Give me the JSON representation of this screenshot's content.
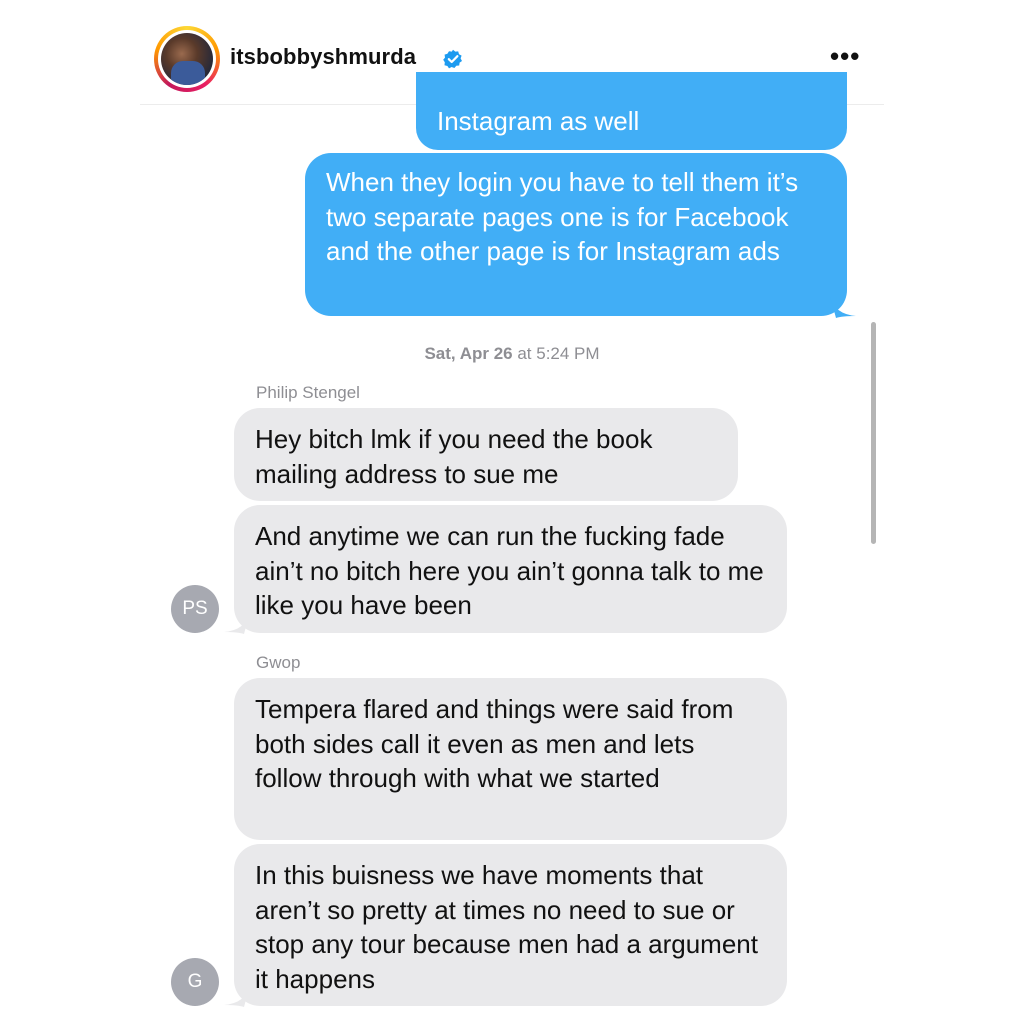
{
  "header": {
    "username": "itsbobbyshmurda",
    "verified_icon": "verified-badge-icon",
    "more_label": "•••"
  },
  "colors": {
    "outgoing": "#41aef6",
    "incoming": "#e9e9eb",
    "verified": "#1d9bf0"
  },
  "messages": {
    "out_1": "Instagram as well",
    "out_2": "When they login you have to tell them it’s two separate pages one is for Facebook and the other page is for Instagram ads",
    "ps_1": "Hey bitch lmk if you need the book mailing address to sue me",
    "ps_2": "And anytime we can run the fucking fade ain’t no bitch here you ain’t gonna talk to me like you have been",
    "g_1": "Tempera flared and things were said from both sides call it even as men and lets follow through with what we started",
    "g_2": "In this buisness we have moments that aren’t so pretty at times no need to sue or stop any tour because men had a argument it happens"
  },
  "timestamp": {
    "day": "Sat, Apr 26",
    "time": " at 5:24 PM"
  },
  "senders": {
    "philip": "Philip Stengel",
    "philip_initials": "PS",
    "gwop": "Gwop",
    "gwop_initials": "G"
  }
}
